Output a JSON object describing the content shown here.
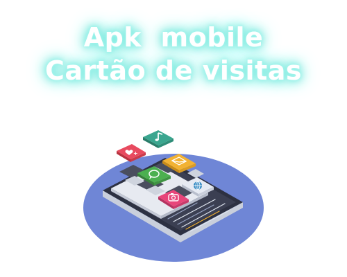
{
  "title": {
    "line1": "Apk  mobile",
    "line2": "Cartão de visitas"
  },
  "illustration": {
    "icons": [
      "heart-icon",
      "music-note-icon",
      "mail-icon",
      "chat-icon",
      "globe-icon",
      "camera-icon"
    ],
    "colors": {
      "ellipse": "#6f86d6",
      "phone_body": "#2d3142",
      "screen": "#3b3f52",
      "tile_heart": "#e84a5f",
      "tile_music": "#3aa68f",
      "tile_mail": "#f2b233",
      "tile_chat": "#4cb050",
      "tile_globe": "#2e86c1",
      "tile_camera": "#e8457a"
    }
  }
}
